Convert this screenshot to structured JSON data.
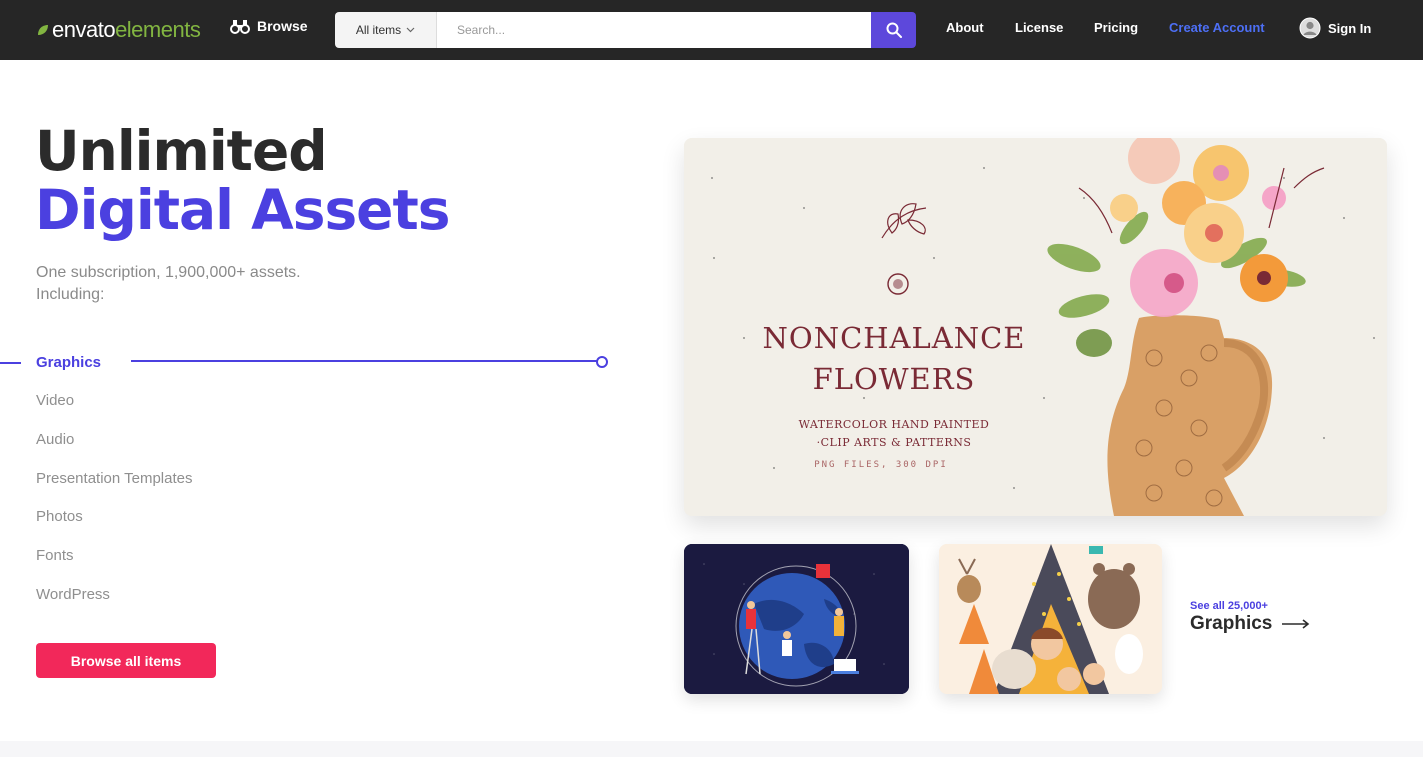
{
  "header": {
    "logo_part1": "envato",
    "logo_part2": "elements",
    "browse_label": "Browse",
    "search_category": "All items",
    "search_placeholder": "Search...",
    "nav": {
      "about": "About",
      "license": "License",
      "pricing": "Pricing",
      "create_account": "Create Account",
      "sign_in": "Sign In"
    }
  },
  "hero": {
    "title_line1": "Unlimited",
    "title_line2": "Digital Assets",
    "subtitle_line1": "One subscription, 1,900,000+ assets.",
    "subtitle_line2": "Including:",
    "categories": [
      {
        "label": "Graphics",
        "active": true
      },
      {
        "label": "Video",
        "active": false
      },
      {
        "label": "Audio",
        "active": false
      },
      {
        "label": "Presentation Templates",
        "active": false
      },
      {
        "label": "Photos",
        "active": false
      },
      {
        "label": "Fonts",
        "active": false
      },
      {
        "label": "WordPress",
        "active": false
      }
    ],
    "cta_label": "Browse all items"
  },
  "featured": {
    "title_line1": "NONCHALANCE",
    "title_line2": "FLOWERS",
    "desc_line1": "WATERCOLOR HAND PAINTED",
    "desc_line2": "·CLIP ARTS & PATTERNS",
    "desc_line3": "PNG FILES, 300 DPI"
  },
  "see_all": {
    "line1": "See all 25,000+",
    "line2": "Graphics"
  },
  "colors": {
    "topbar": "#262626",
    "accent": "#4b40e0",
    "link_accent": "#4d6ff5",
    "logo_green": "#82b541",
    "cta": "#f2285a"
  }
}
